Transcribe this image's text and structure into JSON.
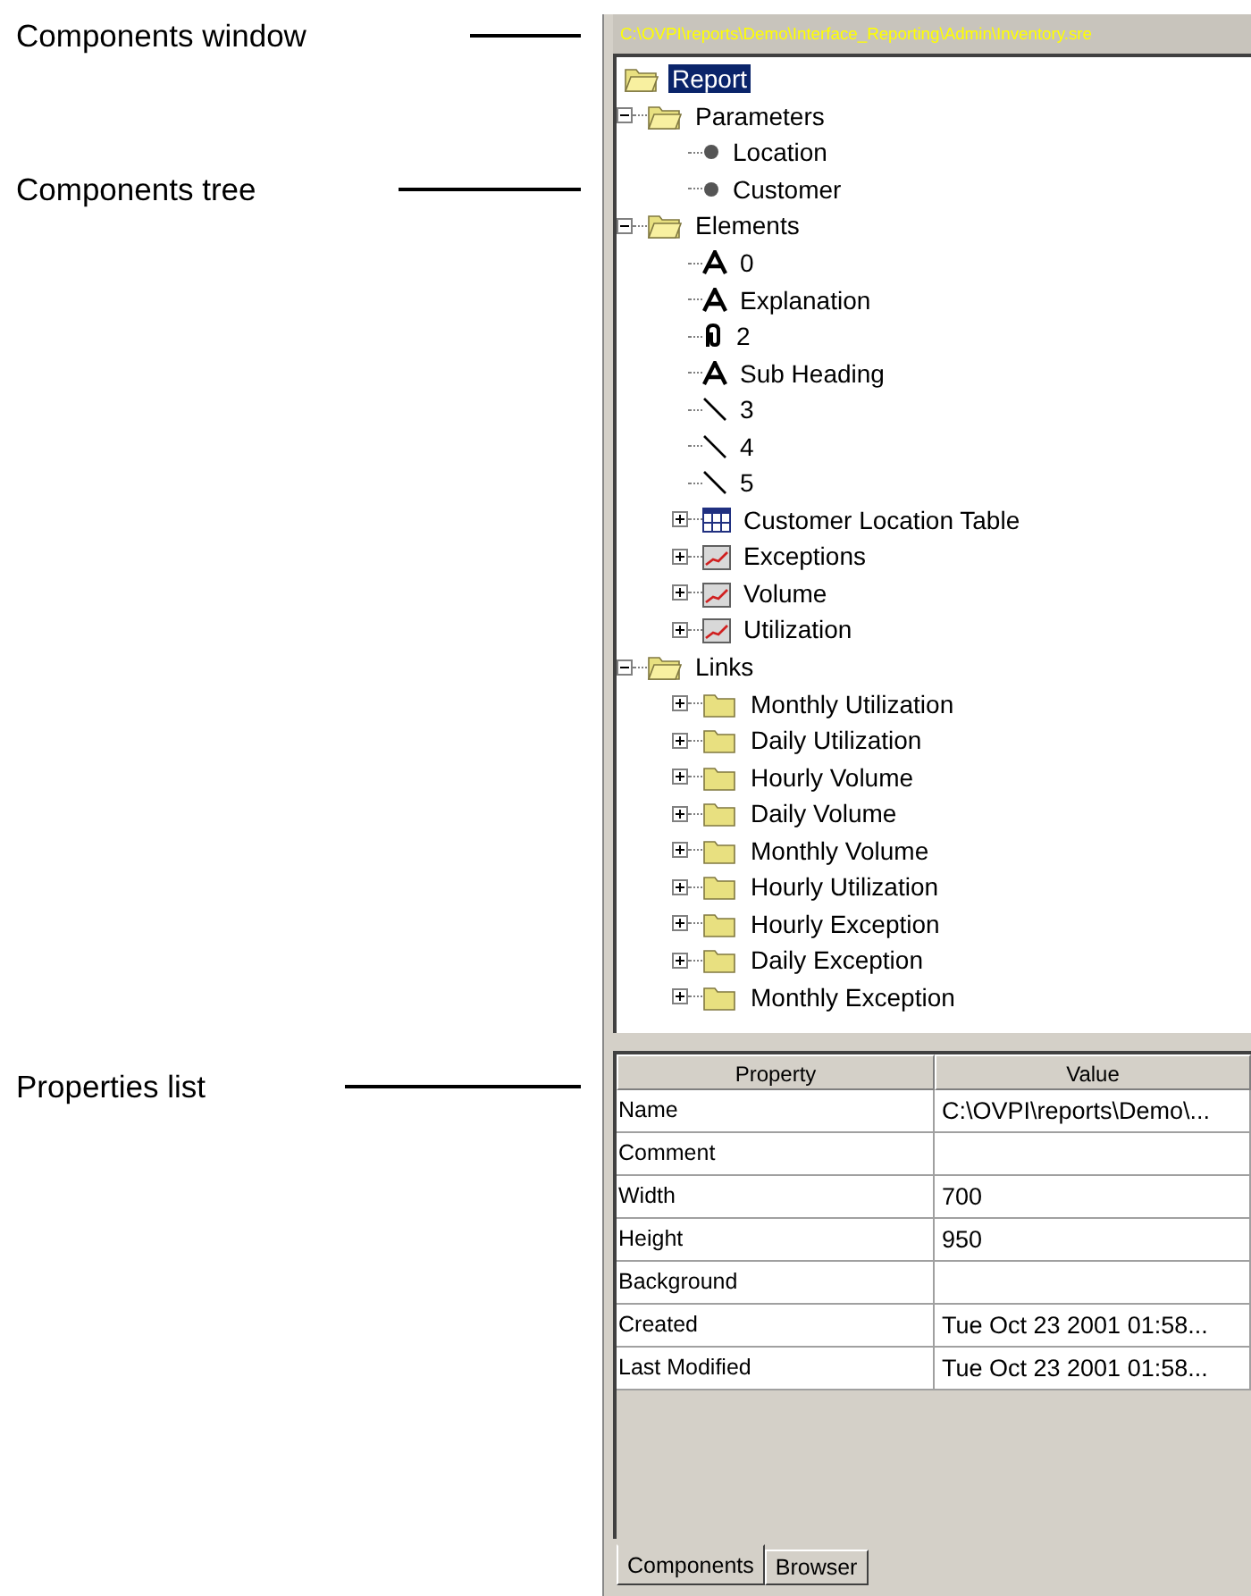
{
  "callouts": [
    {
      "label": "Components window"
    },
    {
      "label": "Components tree"
    },
    {
      "label": "Properties list"
    }
  ],
  "window": {
    "title": "C:\\OVPI\\reports\\Demo\\Interface_Reporting\\Admin\\Inventory.sre"
  },
  "tree": [
    {
      "label": "Report",
      "kind": "folder",
      "selected": true,
      "children": [
        {
          "label": "Parameters",
          "kind": "folder",
          "expanded": true,
          "selected": false,
          "children": [
            {
              "label": "Location",
              "kind": "parameter",
              "selected": false
            },
            {
              "label": "Customer",
              "kind": "parameter",
              "selected": false
            }
          ]
        },
        {
          "label": "Elements",
          "kind": "folder",
          "expanded": true,
          "selected": false,
          "children": [
            {
              "label": "0",
              "kind": "text",
              "selected": false
            },
            {
              "label": "Explanation",
              "kind": "text",
              "selected": false
            },
            {
              "label": "2",
              "kind": "image",
              "selected": false
            },
            {
              "label": "Sub Heading",
              "kind": "text",
              "selected": false
            },
            {
              "label": "3",
              "kind": "line",
              "selected": false
            },
            {
              "label": "4",
              "kind": "line",
              "selected": false
            },
            {
              "label": "5",
              "kind": "line",
              "selected": false
            },
            {
              "label": "Customer Location Table",
              "kind": "table",
              "expanded": false,
              "selected": false
            },
            {
              "label": "Exceptions",
              "kind": "chart",
              "expanded": false,
              "selected": false
            },
            {
              "label": "Volume",
              "kind": "chart",
              "expanded": false,
              "selected": false
            },
            {
              "label": "Utilization",
              "kind": "chart",
              "expanded": false,
              "selected": false
            }
          ]
        },
        {
          "label": "Links",
          "kind": "folder",
          "expanded": true,
          "selected": false,
          "children": [
            {
              "label": "Monthly Utilization",
              "kind": "link",
              "expanded": false,
              "selected": false
            },
            {
              "label": "Daily Utilization",
              "kind": "link",
              "expanded": false,
              "selected": false
            },
            {
              "label": "Hourly Volume",
              "kind": "link",
              "expanded": false,
              "selected": false
            },
            {
              "label": "Daily Volume",
              "kind": "link",
              "expanded": false,
              "selected": false
            },
            {
              "label": "Monthly Volume",
              "kind": "link",
              "expanded": false,
              "selected": false
            },
            {
              "label": "Hourly Utilization",
              "kind": "link",
              "expanded": false,
              "selected": false
            },
            {
              "label": "Hourly Exception",
              "kind": "link",
              "expanded": false,
              "selected": false
            },
            {
              "label": "Daily Exception",
              "kind": "link",
              "expanded": false,
              "selected": false
            },
            {
              "label": "Monthly Exception",
              "kind": "link",
              "expanded": false,
              "selected": false
            }
          ]
        }
      ]
    }
  ],
  "properties": {
    "columns": [
      "Property",
      "Value"
    ],
    "rows": [
      {
        "property": "Name",
        "value": "C:\\OVPI\\reports\\Demo\\..."
      },
      {
        "property": "Comment"
      },
      {
        "property": "Width",
        "value": "700"
      },
      {
        "property": "Height",
        "value": "950"
      },
      {
        "property": "Background"
      },
      {
        "property": "Created",
        "value": "Tue Oct 23 2001 01:58..."
      },
      {
        "property": "Last Modified",
        "value": "Tue Oct 23 2001 01:58..."
      }
    ]
  },
  "tabs": [
    {
      "label": "Components",
      "selected": true
    },
    {
      "label": "Browser",
      "selected": false
    }
  ]
}
